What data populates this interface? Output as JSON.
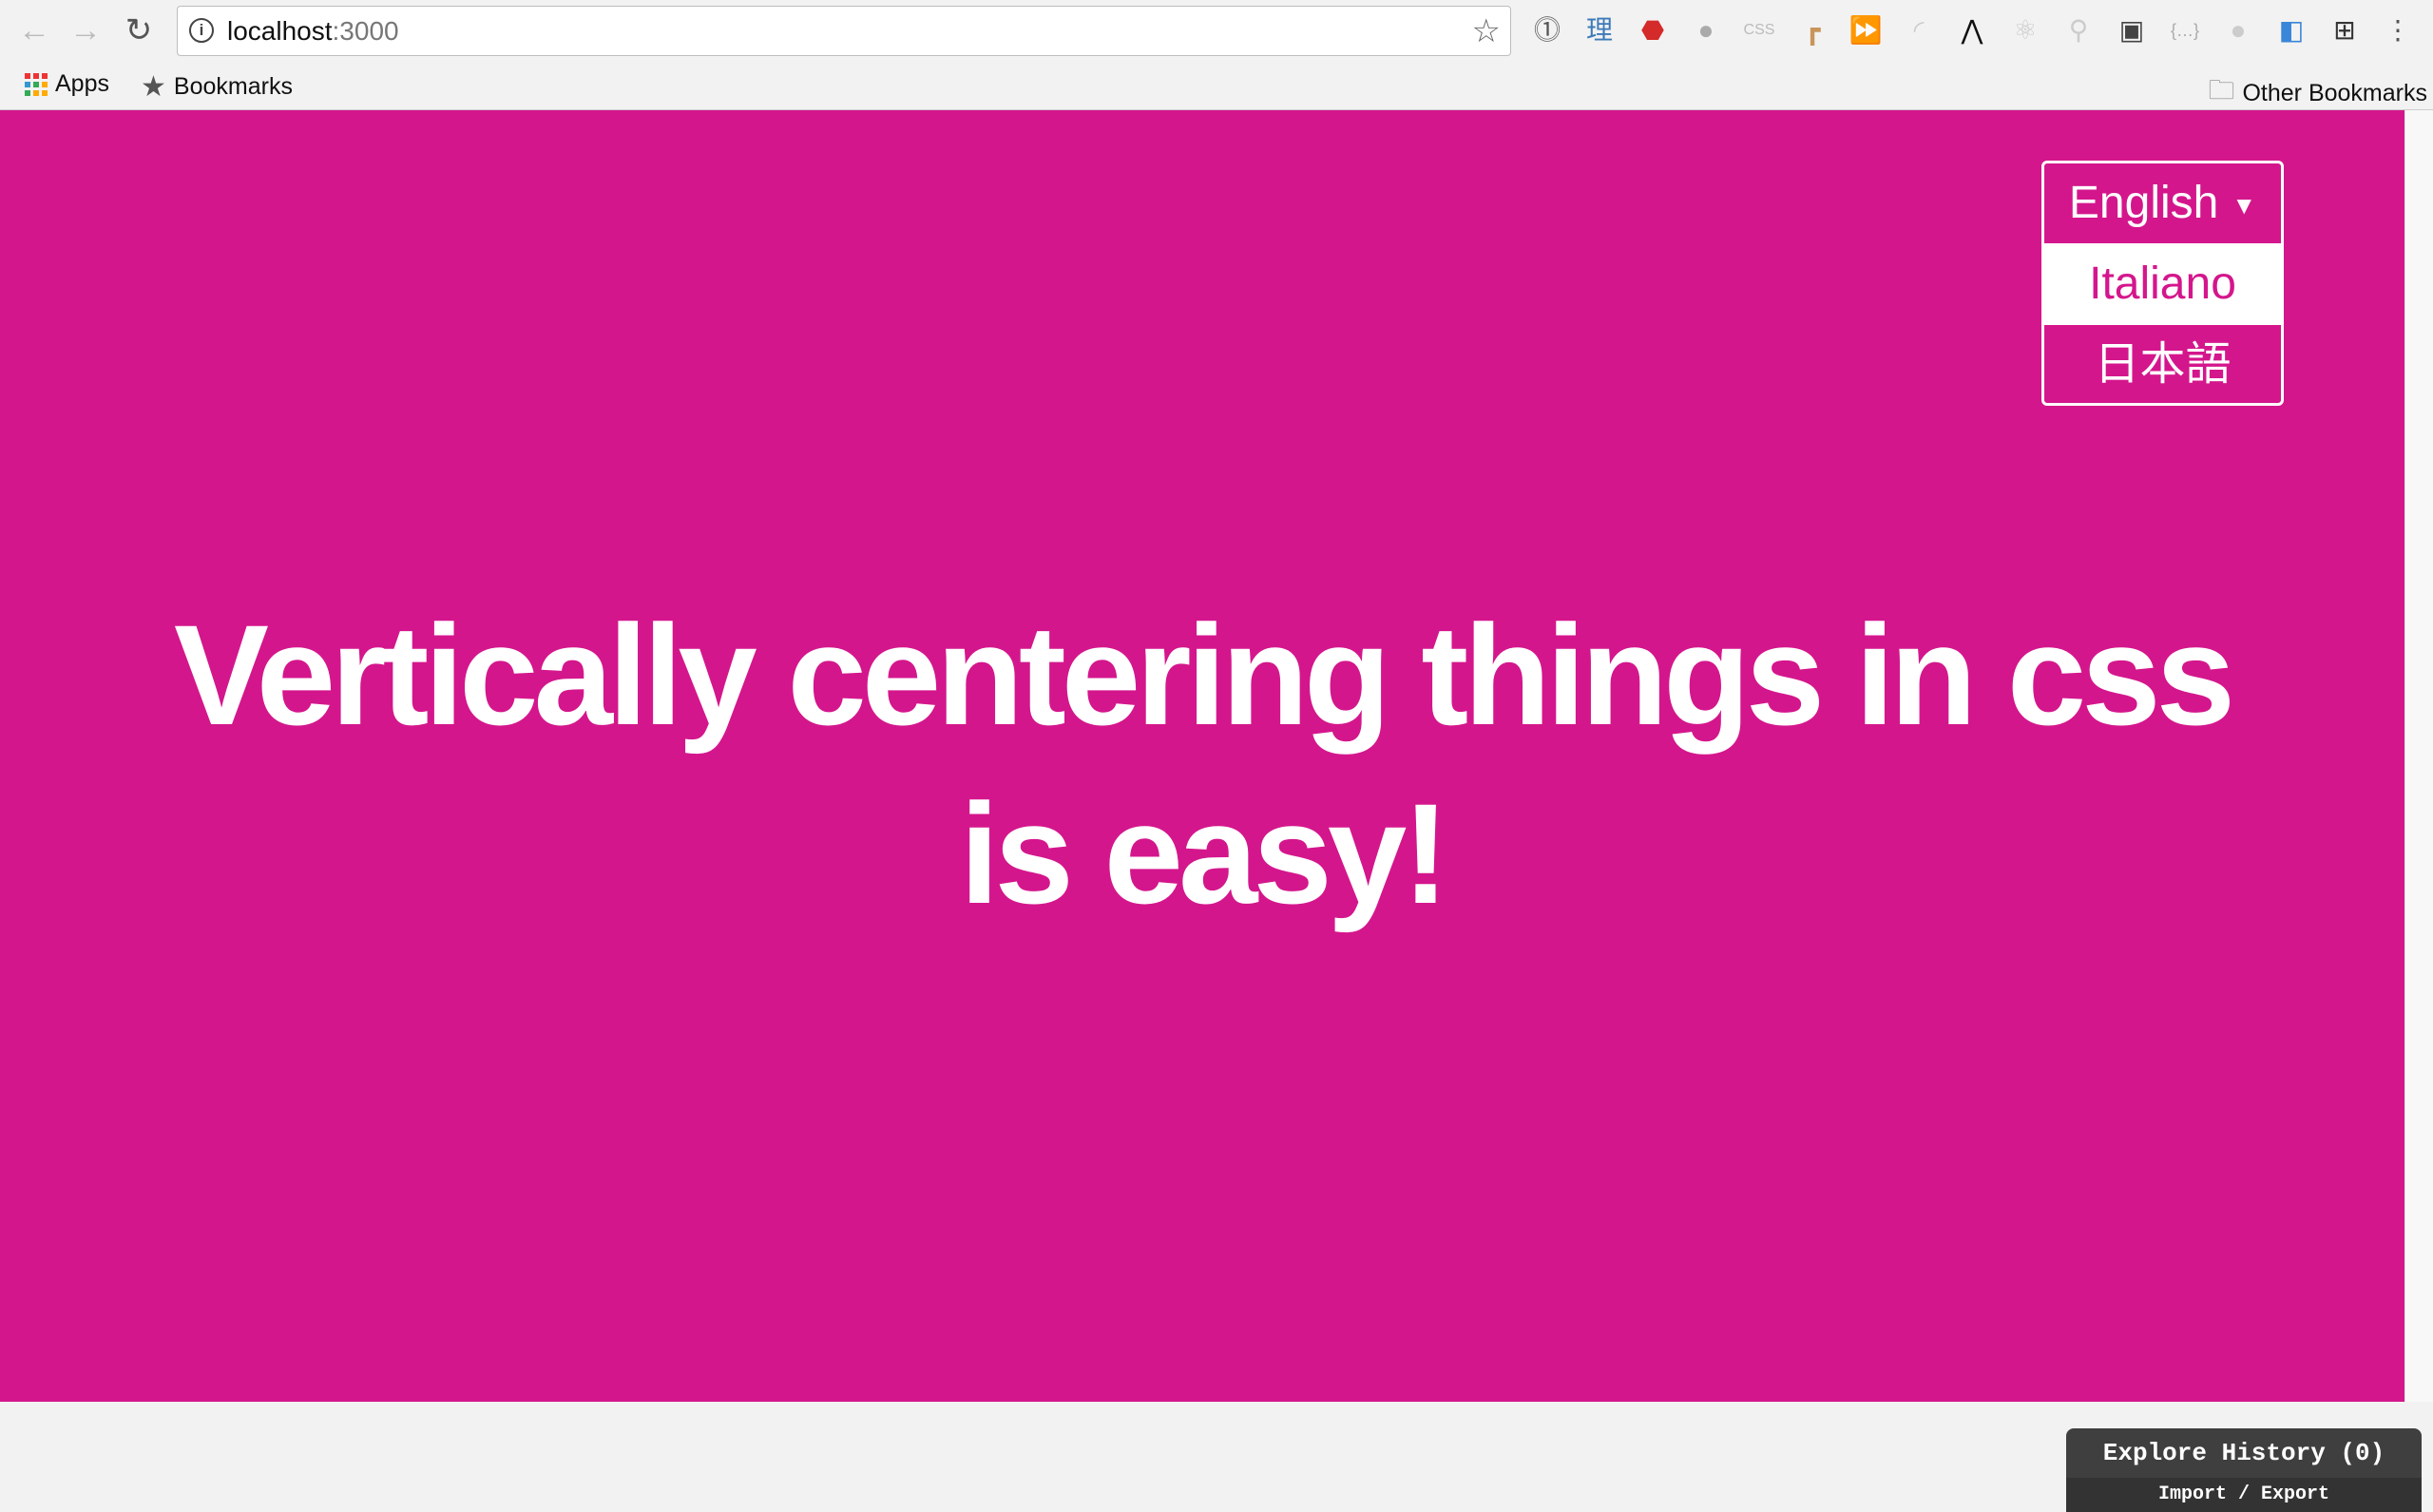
{
  "browser": {
    "url_host": "localhost",
    "url_port": ":3000",
    "bookmarks": [
      {
        "label": "Apps",
        "icon": "apps-grid-icon"
      },
      {
        "label": "Bookmarks",
        "icon": "star-icon"
      }
    ],
    "other_bookmarks": "Other Bookmarks",
    "extensions": [
      "1password-icon",
      "rikaikun-icon",
      "adblock-icon",
      "vimium-icon",
      "css-viewer-icon",
      "ruler-icon",
      "video-speed-icon",
      "feedly-icon",
      "extension-icon",
      "react-devtools-icon",
      "redux-devtools-icon",
      "outlet-icon",
      "json-viewer-icon",
      "extension-icon",
      "tag-icon",
      "grid-icon"
    ]
  },
  "language_menu": {
    "selected": "English",
    "options": [
      "English",
      "Italiano",
      "日本語"
    ],
    "highlighted": "Italiano"
  },
  "heading": {
    "line1": "Vertically centering things in css",
    "line2": "is easy!"
  },
  "history_panel": {
    "title": "Explore History (0)",
    "actions": "Import / Export"
  },
  "colors": {
    "background": "#d4168c",
    "text": "#ffffff",
    "panel": "#3f3f3f"
  }
}
